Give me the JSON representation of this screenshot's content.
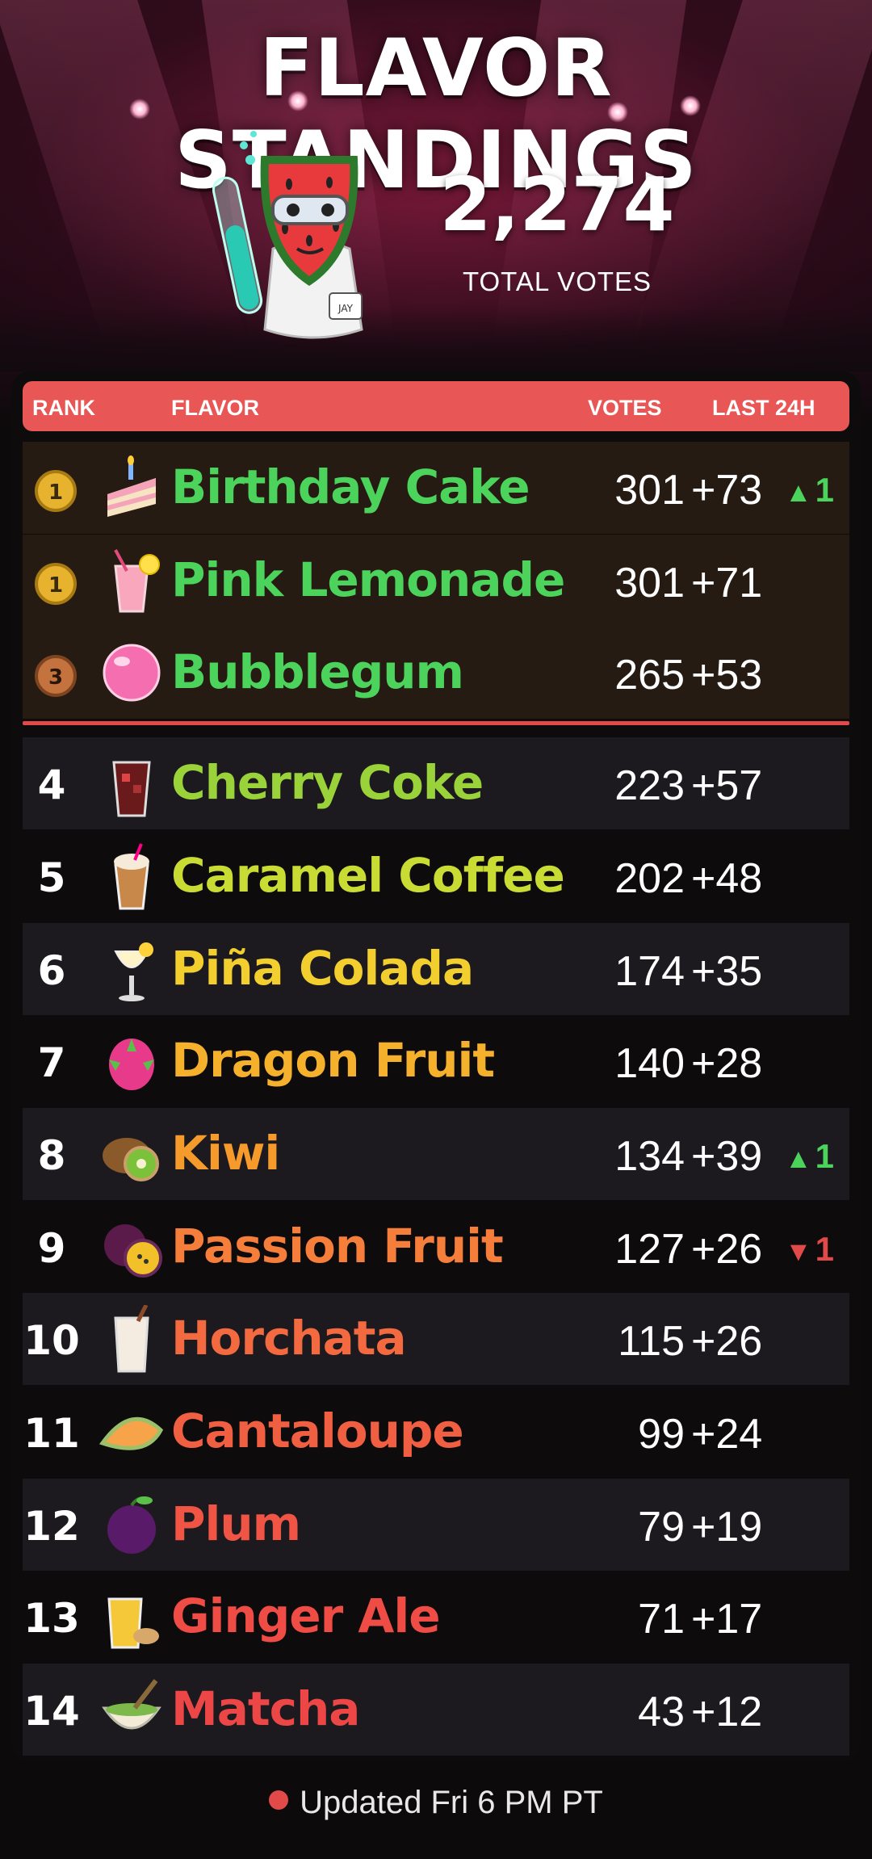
{
  "title": "FLAVOR STANDINGS",
  "mascot": {
    "badge_text": "JAY"
  },
  "total": {
    "value": "2,274",
    "label": "TOTAL VOTES"
  },
  "columns": {
    "rank": "RANK",
    "flavor": "FLAVOR",
    "votes": "VOTES",
    "last24h": "LAST 24H"
  },
  "rows": [
    {
      "rank": "1",
      "flavor": "Birthday Cake",
      "votes": "301",
      "delta": "+73",
      "move": "1",
      "move_dir": "up",
      "color": "#4bd35c",
      "icon": "cake-icon"
    },
    {
      "rank": "1",
      "flavor": "Pink Lemonade",
      "votes": "301",
      "delta": "+71",
      "move": "",
      "move_dir": "",
      "color": "#4bd35c",
      "icon": "lemonade-icon"
    },
    {
      "rank": "3",
      "flavor": "Bubblegum",
      "votes": "265",
      "delta": "+53",
      "move": "",
      "move_dir": "",
      "color": "#4bd35c",
      "icon": "bubblegum-icon"
    },
    {
      "rank": "4",
      "flavor": "Cherry Coke",
      "votes": "223",
      "delta": "+57",
      "move": "",
      "move_dir": "",
      "color": "#9ad23a",
      "icon": "cola-glass-icon"
    },
    {
      "rank": "5",
      "flavor": "Caramel Coffee",
      "votes": "202",
      "delta": "+48",
      "move": "",
      "move_dir": "",
      "color": "#c8dc34",
      "icon": "iced-coffee-icon"
    },
    {
      "rank": "6",
      "flavor": "Piña Colada",
      "votes": "174",
      "delta": "+35",
      "move": "",
      "move_dir": "",
      "color": "#f2cf2e",
      "icon": "pina-colada-icon"
    },
    {
      "rank": "7",
      "flavor": "Dragon Fruit",
      "votes": "140",
      "delta": "+28",
      "move": "",
      "move_dir": "",
      "color": "#f5b02c",
      "icon": "dragon-fruit-icon"
    },
    {
      "rank": "8",
      "flavor": "Kiwi",
      "votes": "134",
      "delta": "+39",
      "move": "1",
      "move_dir": "up",
      "color": "#f69a2c",
      "icon": "kiwi-icon"
    },
    {
      "rank": "9",
      "flavor": "Passion Fruit",
      "votes": "127",
      "delta": "+26",
      "move": "1",
      "move_dir": "down",
      "color": "#f57e3a",
      "icon": "passion-fruit-icon"
    },
    {
      "rank": "10",
      "flavor": "Horchata",
      "votes": "115",
      "delta": "+26",
      "move": "",
      "move_dir": "",
      "color": "#f36a40",
      "icon": "horchata-icon"
    },
    {
      "rank": "11",
      "flavor": "Cantaloupe",
      "votes": "99",
      "delta": "+24",
      "move": "",
      "move_dir": "",
      "color": "#f15f42",
      "icon": "cantaloupe-icon"
    },
    {
      "rank": "12",
      "flavor": "Plum",
      "votes": "79",
      "delta": "+19",
      "move": "",
      "move_dir": "",
      "color": "#ef5444",
      "icon": "plum-icon"
    },
    {
      "rank": "13",
      "flavor": "Ginger Ale",
      "votes": "71",
      "delta": "+17",
      "move": "",
      "move_dir": "",
      "color": "#ee4c44",
      "icon": "ginger-ale-icon"
    },
    {
      "rank": "14",
      "flavor": "Matcha",
      "votes": "43",
      "delta": "+12",
      "move": "",
      "move_dir": "",
      "color": "#ec4646",
      "icon": "matcha-icon"
    }
  ],
  "footer": {
    "updated": "Updated Fri 6 PM PT"
  },
  "colors": {
    "accent": "#e85656",
    "up": "#4bd35c",
    "down": "#e24a4a",
    "medal_gold": "#e7b32e",
    "medal_bronze": "#c5733e"
  }
}
